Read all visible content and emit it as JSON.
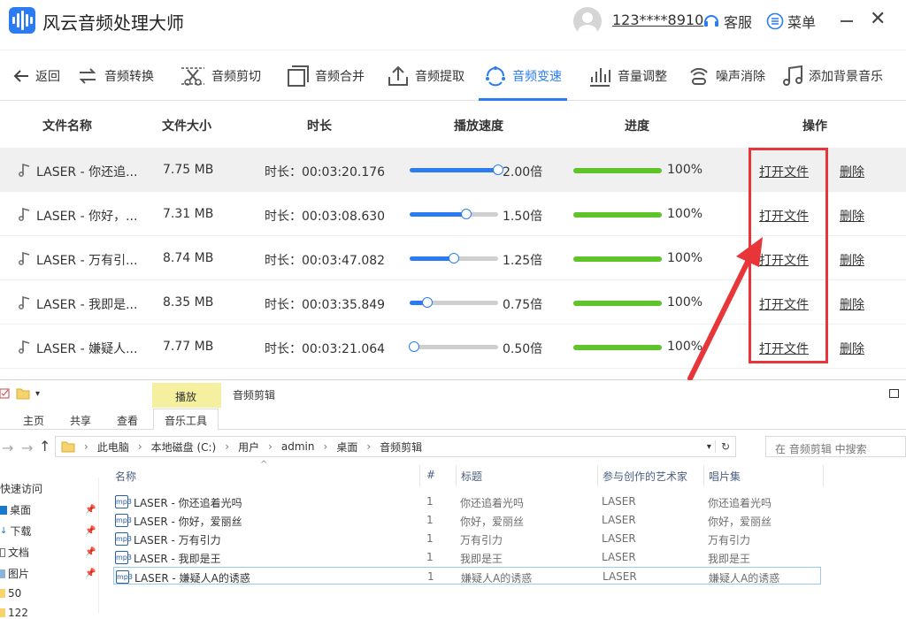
{
  "app": {
    "title": "风云音频处理大师",
    "phone": "123****8910",
    "service_label": "客服",
    "menu_label": "菜单",
    "accent_color": "#2b7cf3",
    "progress_color": "#5ec42a",
    "highlight_color": "#e8353a"
  },
  "toolbar": {
    "back": "返回",
    "items": [
      {
        "label": "音频转换",
        "icon": "convert-icon",
        "active": false
      },
      {
        "label": "音频剪切",
        "icon": "cut-icon",
        "active": false
      },
      {
        "label": "音频合并",
        "icon": "merge-icon",
        "active": false
      },
      {
        "label": "音频提取",
        "icon": "extract-icon",
        "active": false
      },
      {
        "label": "音频变速",
        "icon": "speed-icon",
        "active": true
      },
      {
        "label": "音量调整",
        "icon": "volume-icon",
        "active": false
      },
      {
        "label": "噪声消除",
        "icon": "denoise-icon",
        "active": false
      },
      {
        "label": "添加背景音乐",
        "icon": "music-icon",
        "active": false
      }
    ]
  },
  "table": {
    "headers": [
      "文件名称",
      "文件大小",
      "时长",
      "播放速度",
      "进度",
      "操作"
    ],
    "rows": [
      {
        "name": "LASER - 你还追...",
        "size": "7.75 MB",
        "duration": "时长：00:03:20.176",
        "speed_label": "2.00倍",
        "speed_pct": 100,
        "progress_label": "100%",
        "progress": 1.0,
        "open": "打开文件",
        "delete": "删除"
      },
      {
        "name": "LASER - 你好，...",
        "size": "7.31 MB",
        "duration": "时长：00:03:08.630",
        "speed_label": "1.50倍",
        "speed_pct": 64,
        "progress_label": "100%",
        "progress": 1.0,
        "open": "打开文件",
        "delete": "删除"
      },
      {
        "name": "LASER - 万有引...",
        "size": "8.74 MB",
        "duration": "时长：00:03:47.082",
        "speed_label": "1.25倍",
        "speed_pct": 50,
        "progress_label": "100%",
        "progress": 1.0,
        "open": "打开文件",
        "delete": "删除"
      },
      {
        "name": "LASER - 我即是...",
        "size": "8.35 MB",
        "duration": "时长：00:03:35.849",
        "speed_label": "0.75倍",
        "speed_pct": 20,
        "progress_label": "100%",
        "progress": 1.0,
        "open": "打开文件",
        "delete": "删除"
      },
      {
        "name": "LASER - 嫌疑人...",
        "size": "7.77 MB",
        "duration": "时长：00:03:21.064",
        "speed_label": "0.50倍",
        "speed_pct": 5,
        "progress_label": "100%",
        "progress": 1.0,
        "open": "打开文件",
        "delete": "删除"
      }
    ]
  },
  "explorer": {
    "context_tab": "播放",
    "window_title": "音频剪辑",
    "tabs": [
      "主页",
      "共享",
      "查看",
      "音乐工具"
    ],
    "breadcrumb": [
      "此电脑",
      "本地磁盘 (C:)",
      "用户",
      "admin",
      "桌面",
      "音频剪辑"
    ],
    "search_placeholder": "在 音频剪辑 中搜索",
    "nav": [
      {
        "label": "快速访问",
        "pinned": false
      },
      {
        "label": "桌面",
        "pinned": true
      },
      {
        "label": "下载",
        "pinned": true
      },
      {
        "label": "文档",
        "pinned": true
      },
      {
        "label": "图片",
        "pinned": true
      },
      {
        "label": "50",
        "pinned": false
      },
      {
        "label": "122",
        "pinned": false
      }
    ],
    "columns": [
      "名称",
      "#",
      "标题",
      "参与创作的艺术家",
      "唱片集"
    ],
    "files": [
      {
        "name": "LASER - 你还追着光吗",
        "num": "1",
        "title": "你还追着光吗",
        "artist": "LASER",
        "album": "你还追着光吗"
      },
      {
        "name": "LASER - 你好，爱丽丝",
        "num": "1",
        "title": "你好，爱丽丝",
        "artist": "LASER",
        "album": "你好，爱丽丝"
      },
      {
        "name": "LASER - 万有引力",
        "num": "1",
        "title": "万有引力",
        "artist": "LASER",
        "album": "万有引力"
      },
      {
        "name": "LASER - 我即是王",
        "num": "1",
        "title": "我即是王",
        "artist": "LASER",
        "album": "我即是王"
      },
      {
        "name": "LASER - 嫌疑人A的诱惑",
        "num": "1",
        "title": "嫌疑人A的诱惑",
        "artist": "LASER",
        "album": "嫌疑人A的诱惑"
      }
    ]
  }
}
